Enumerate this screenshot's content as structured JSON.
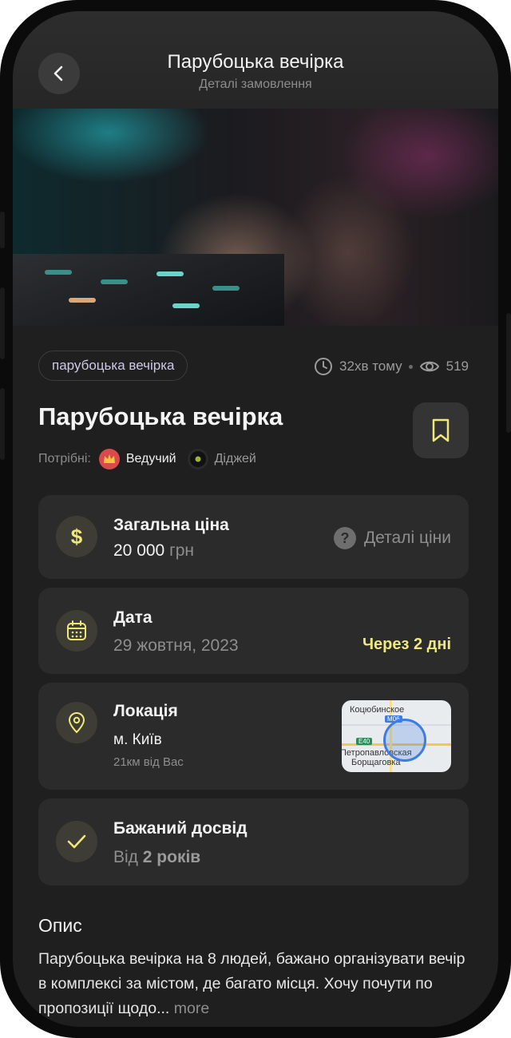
{
  "header": {
    "title": "Парубоцька вечірка",
    "subtitle": "Деталі замовлення"
  },
  "hero_image": {
    "alt": "party crowd with DJ deck"
  },
  "tag": "парубоцька вечірка",
  "meta": {
    "time_ago": "32хв тому",
    "views": "519"
  },
  "title": "Парубоцька вечірка",
  "needed": {
    "label": "Потрібні:",
    "roles": [
      {
        "name": "Ведучий",
        "icon": "crown-icon",
        "active": true
      },
      {
        "name": "Діджей",
        "icon": "vinyl-icon",
        "active": false
      }
    ]
  },
  "price": {
    "label": "Загальна ціна",
    "amount": "20 000",
    "currency": "грн",
    "details_label": "Деталі ціни"
  },
  "date": {
    "label": "Дата",
    "value": "29 жовтня, 2023",
    "relative": "Через 2 дні"
  },
  "location": {
    "label": "Локація",
    "city": "м. Київ",
    "distance": "21км  від Вас",
    "map": {
      "labels": [
        "Коцюбинское",
        "Петропавловская",
        "Борщаговка"
      ],
      "road_shields": [
        "M06",
        "E40"
      ]
    }
  },
  "experience": {
    "label": "Бажаний досвід",
    "prefix": "Від",
    "value": "2 років"
  },
  "description": {
    "title": "Опис",
    "text": "Парубоцька вечірка на 8 людей, бажано організувати вечір в комплексі за містом, де багато місця. Хочу почути по пропозиції щодо...",
    "more": "more"
  },
  "colors": {
    "background": "#1f1f1f",
    "card": "#2b2b2b",
    "accent": "#efe87c",
    "tag_text": "#cfc8e8"
  }
}
